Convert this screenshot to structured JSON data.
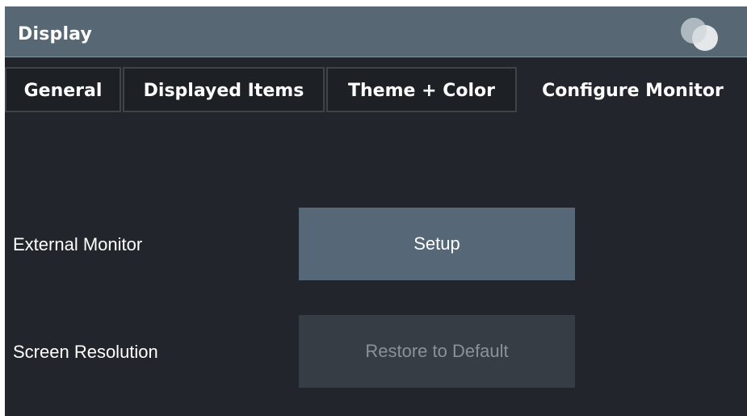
{
  "window": {
    "title": "Display"
  },
  "tabs": [
    {
      "label": "General",
      "active": false
    },
    {
      "label": "Displayed Items",
      "active": false
    },
    {
      "label": "Theme + Color",
      "active": false
    },
    {
      "label": "Configure Monitor",
      "active": true
    }
  ],
  "rows": {
    "external_monitor": {
      "label": "External Monitor",
      "button": "Setup",
      "enabled": true
    },
    "screen_resolution": {
      "label": "Screen Resolution",
      "button": "Restore to Default",
      "enabled": false
    }
  },
  "icons": {
    "logo": "overlapping-circles-logo-icon"
  },
  "colors": {
    "titlebar": "#576773",
    "background": "#22252b",
    "tab_inactive": "#1d2025",
    "button_enabled": "#566877",
    "button_disabled": "#373d44",
    "text_disabled": "#8b9197"
  }
}
